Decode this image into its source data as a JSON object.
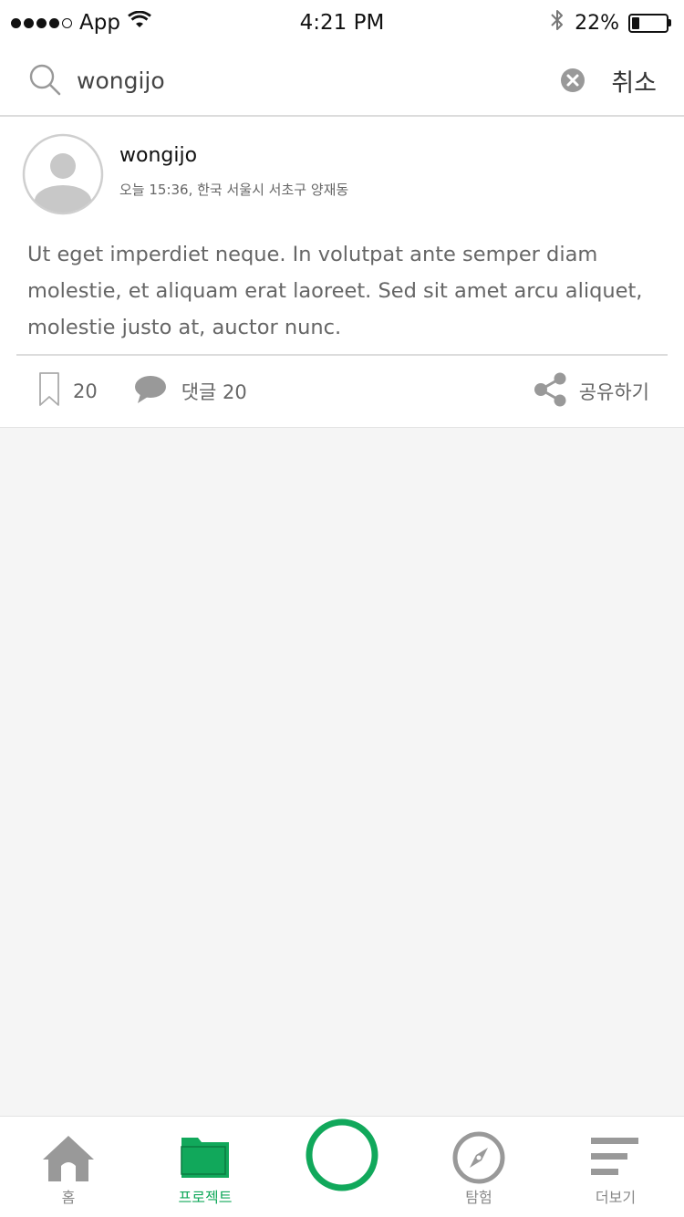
{
  "status_bar": {
    "carrier": "App",
    "time": "4:21 PM",
    "battery_percent": "22%",
    "battery_level": 0.22,
    "icons": [
      "signal-dots",
      "wifi-icon",
      "bluetooth-icon",
      "battery-icon"
    ]
  },
  "search": {
    "value": "wongijo",
    "cancel_label": "취소"
  },
  "post": {
    "author": "wongijo",
    "info": "오늘 15:36, 한국 서울시 서초구 양재동",
    "body": "Ut eget imperdiet neque. In volutpat ante semper diam molestie, et aliquam erat laoreet. Sed sit amet arcu aliquet, molestie justo at, auctor nunc.",
    "bookmark_count": "20",
    "comment_label": "댓글 20",
    "share_label": "공유하기"
  },
  "tabs": [
    {
      "label": "홈",
      "icon": "home-icon",
      "active": false
    },
    {
      "label": "프로젝트",
      "icon": "folder-icon",
      "active": true
    },
    {
      "label": "",
      "icon": "record-circle-icon",
      "active": false
    },
    {
      "label": "탐험",
      "icon": "compass-icon",
      "active": false
    },
    {
      "label": "더보기",
      "icon": "menu-icon",
      "active": false
    }
  ],
  "colors": {
    "accent": "#11a85b",
    "icon_gray": "#999999",
    "background": "#f5f5f5"
  }
}
